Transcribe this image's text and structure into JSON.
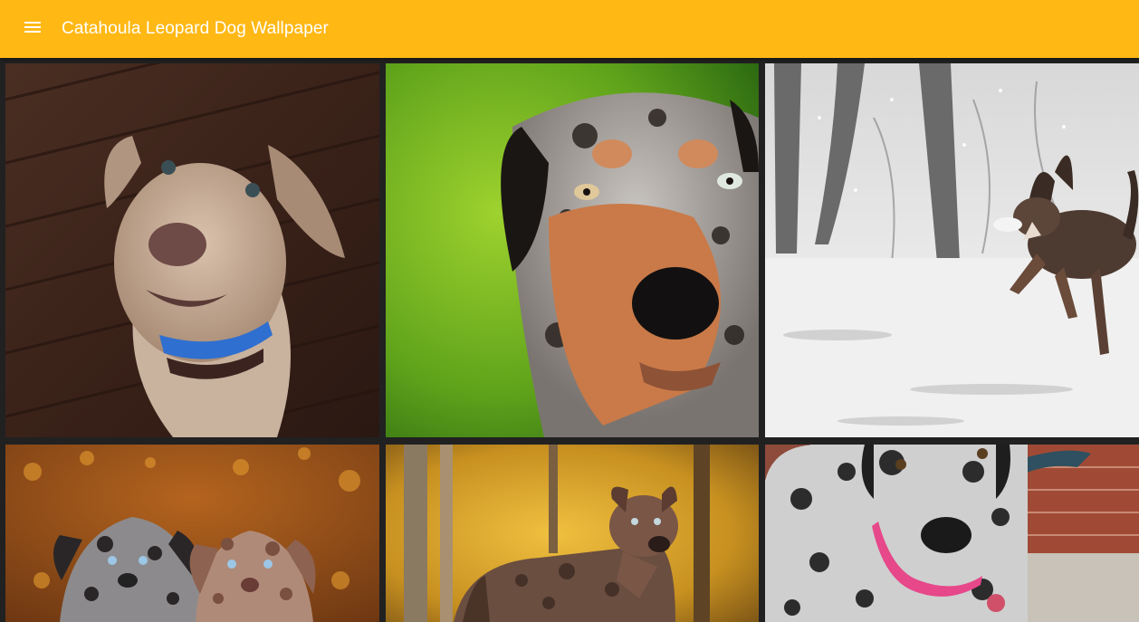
{
  "app_bar": {
    "title": "Catahoula Leopard Dog Wallpaper",
    "menu_icon": "menu-icon",
    "background_color": "#FFB814",
    "title_color": "#FFFFFF"
  },
  "gallery": {
    "background_color": "#212121",
    "wallpapers": [
      {
        "subject": "tan-dog-blue-collar-on-wood-floor"
      },
      {
        "subject": "merle-dog-closeup-green-background"
      },
      {
        "subject": "dog-running-in-snow"
      },
      {
        "subject": "two-merle-puppies-in-autumn-leaves"
      },
      {
        "subject": "brindle-dog-in-autumn-forest"
      },
      {
        "subject": "merle-puppy-pink-collar"
      }
    ]
  }
}
